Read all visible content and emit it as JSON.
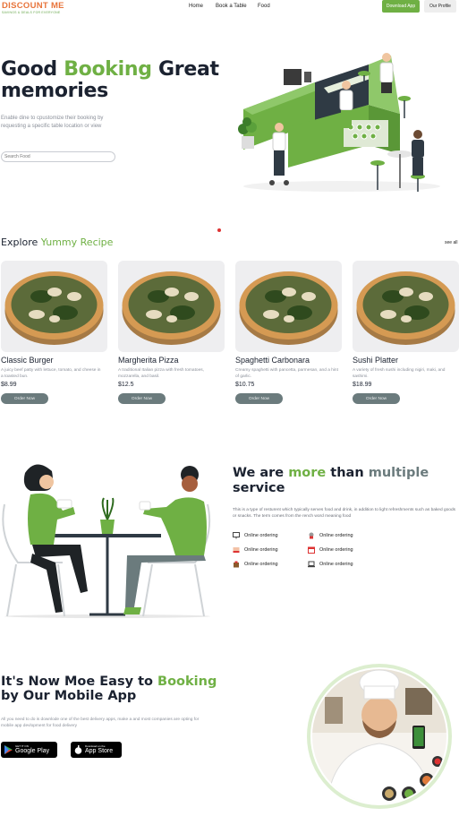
{
  "header": {
    "logo_main": "DISCOUNT ME",
    "logo_tagline": "SAVINGS & DEALS FOR EVERYONE",
    "nav": [
      "Home",
      "Book a Table",
      "Food"
    ],
    "download_label": "Download App",
    "profile_label": "Our Profile",
    "accent_color": "#6fb044"
  },
  "hero": {
    "title_part1": "Good ",
    "title_highlight": "Booking",
    "title_part2": " Great",
    "title_line2": "memories",
    "subtitle": "Enable dine to cpustomize their booking by requesting a specific table location or view",
    "search_placeholder": "Search Food"
  },
  "recipes": {
    "title_part1": "Explore ",
    "title_highlight": "Yummy Recipe",
    "see_all": "see all",
    "order_label": "Order Now",
    "items": [
      {
        "name": "Classic Burger",
        "desc": "A juicy beef patty with lettuce, tomato, and cheese in a toasted bun.",
        "price": "$8.99"
      },
      {
        "name": "Margherita Pizza",
        "desc": "A traditional Italian pizza with fresh tomatoes, mozzarella, and basil.",
        "price": "$12.5"
      },
      {
        "name": "Spaghetti Carbonara",
        "desc": "Creamy spaghetti with pancetta, parmesan, and a hint of garlic.",
        "price": "$10.75"
      },
      {
        "name": "Sushi Platter",
        "desc": "A variety of fresh sushi including nigiri, maki, and sashimi.",
        "price": "$18.99"
      }
    ]
  },
  "service": {
    "title_part1": "We are ",
    "title_highlight": "more",
    "title_part2": " than  ",
    "title_grey": "multiple",
    "title_line2": "service",
    "desc": "This is a type of resturent which typically serves food and drink, in addition to light refreshments such as baked goods or snacks. The term comes from the rench word meaning food",
    "features": [
      "Online ordering",
      "Online ordering",
      "Online ordering",
      "Online ordering",
      "Online ordering",
      "Online ordering"
    ]
  },
  "app": {
    "title_part1": "It's Now Moe Easy to ",
    "title_highlight": "Booking",
    "title_line2": "by Our Mobile App",
    "desc": "All you need to do is downlode one of the best delivery apps, make a and most companies are opting for mobile app devlopment for food delivery",
    "google_small": "GET IT ON",
    "google_big": "Google Play",
    "apple_small": "Download on the",
    "apple_big": "App Store"
  }
}
